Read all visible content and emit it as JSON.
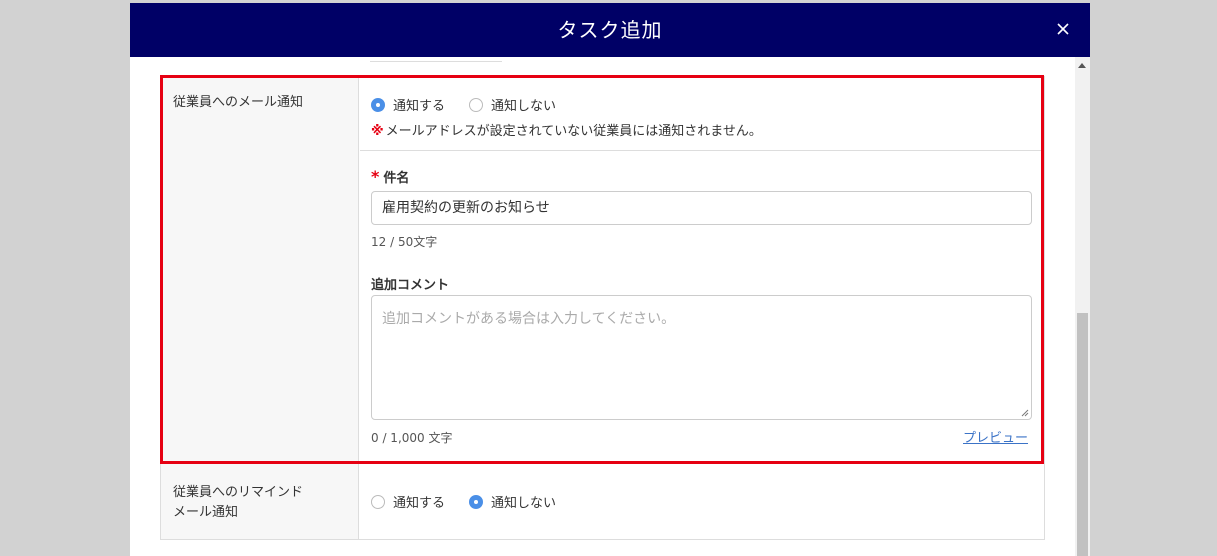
{
  "modal": {
    "title": "タスク追加",
    "header_color": "#000066"
  },
  "email_notification": {
    "label": "従業員へのメール通知",
    "options": [
      "通知する",
      "通知しない"
    ],
    "selected": "通知する",
    "note_mark": "※",
    "note": "メールアドレスが設定されていない従業員には通知されません。",
    "subject": {
      "required_mark": "*",
      "label": "件名",
      "value": "雇用契約の更新のお知らせ",
      "counter": "12 / 50文字"
    },
    "comment": {
      "label": "追加コメント",
      "placeholder": "追加コメントがある場合は入力してください。",
      "counter": "0 / 1,000 文字",
      "preview_link": "プレビュー"
    }
  },
  "reminder_notification": {
    "label_line1": "従業員へのリマインド",
    "label_line2": "メール通知",
    "options": [
      "通知する",
      "通知しない"
    ],
    "selected": "通知しない"
  },
  "colors": {
    "accent": "#4a8fe7",
    "required": "#e60012",
    "highlight_border": "#e60012",
    "link": "#3b73c7"
  }
}
